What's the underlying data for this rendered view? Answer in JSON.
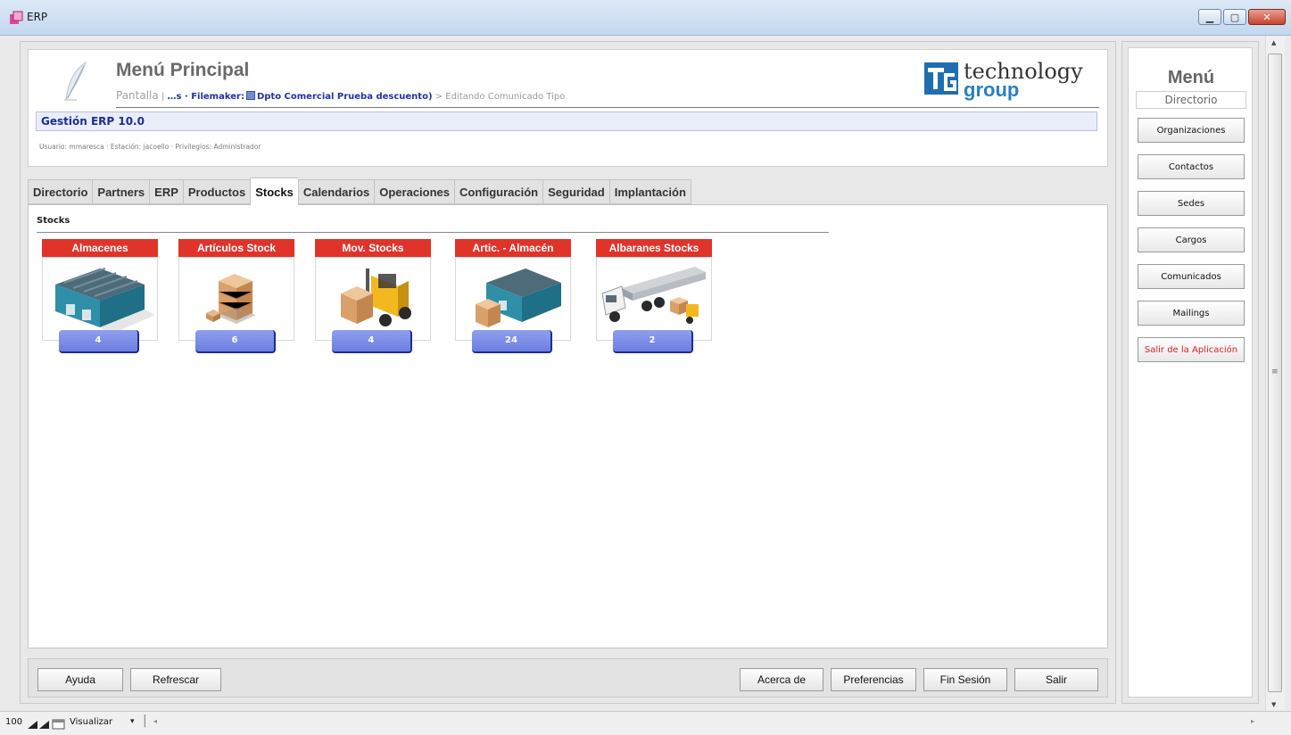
{
  "window": {
    "title": "ERP"
  },
  "header": {
    "title": "Menú Principal",
    "breadcrumb_pantalla": "Pantalla",
    "breadcrumb_sep": "|",
    "breadcrumb_prefix": "…s · Filemaker:",
    "breadcrumb_link": "Dpto Comercial Prueba descuento)",
    "breadcrumb_suffix": "> Editando Comunicado Tipo",
    "logo_text_top": "technology",
    "logo_text_bottom": "group",
    "app_version": "Gestión ERP 10.0",
    "user_line": "Usuario: mmaresca · Estación: jacoello · Privilegios: Administrador"
  },
  "tabs": [
    {
      "label": "Directorio",
      "active": false
    },
    {
      "label": "Partners",
      "active": false
    },
    {
      "label": "ERP",
      "active": false
    },
    {
      "label": "Productos",
      "active": false
    },
    {
      "label": "Stocks",
      "active": true
    },
    {
      "label": "Calendarios",
      "active": false
    },
    {
      "label": "Operaciones",
      "active": false
    },
    {
      "label": "Configuración",
      "active": false
    },
    {
      "label": "Seguridad",
      "active": false
    },
    {
      "label": "Implantación",
      "active": false
    }
  ],
  "section": {
    "title": "Stocks"
  },
  "tiles": [
    {
      "label": "Almacenes",
      "count": "4",
      "icon": "warehouse-icon"
    },
    {
      "label": "Artículos Stock",
      "count": "6",
      "icon": "boxes-icon"
    },
    {
      "label": "Mov. Stocks",
      "count": "4",
      "icon": "forklift-icon"
    },
    {
      "label": "Artic. - Almacén",
      "count": "24",
      "icon": "warehouse-boxes-icon"
    },
    {
      "label": "Albaranes Stocks",
      "count": "2",
      "icon": "truck-icon"
    }
  ],
  "footer": {
    "help": "Ayuda",
    "refresh": "Refrescar",
    "about": "Acerca de",
    "preferences": "Preferencias",
    "end_session": "Fin Sesión",
    "exit": "Salir"
  },
  "side_menu": {
    "title": "Menú",
    "subtitle": "Directorio",
    "items": [
      "Organizaciones",
      "Contactos",
      "Sedes",
      "Cargos",
      "Comunicados",
      "Mailings"
    ],
    "exit_label": "Salir de la Aplicación"
  },
  "statusbar": {
    "zoom": "100",
    "view_mode": "Visualizar"
  },
  "colors": {
    "tile_label": "#e0332a",
    "badge": "#7b8ee6",
    "version_text": "#1b2e96",
    "exit_text": "#e02020"
  }
}
